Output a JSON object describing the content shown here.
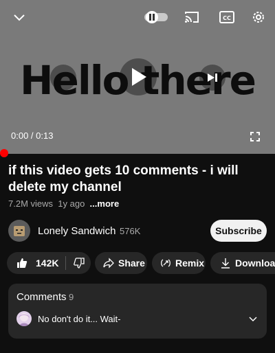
{
  "player": {
    "overlay_word": "Hello there",
    "time_current": "0:00",
    "time_separator": " / ",
    "time_total": "0:13",
    "progress_fraction": 0.0
  },
  "video": {
    "title": "if this video gets 10 comments - i will delete my channel",
    "views": "7.2M views",
    "age": "1y ago",
    "more_label": "...more"
  },
  "channel": {
    "name": "Lonely Sandwich",
    "subscribers": "576K",
    "subscribe_label": "Subscribe"
  },
  "actions": {
    "likes": "142K",
    "share_label": "Share",
    "remix_label": "Remix",
    "download_label": "Download"
  },
  "comments": {
    "title": "Comments",
    "count": "9",
    "top_comment": "No don't do it... Wait-"
  },
  "colors": {
    "progress": "#ff0000",
    "background": "#0f0f0f",
    "pill": "#272727"
  }
}
